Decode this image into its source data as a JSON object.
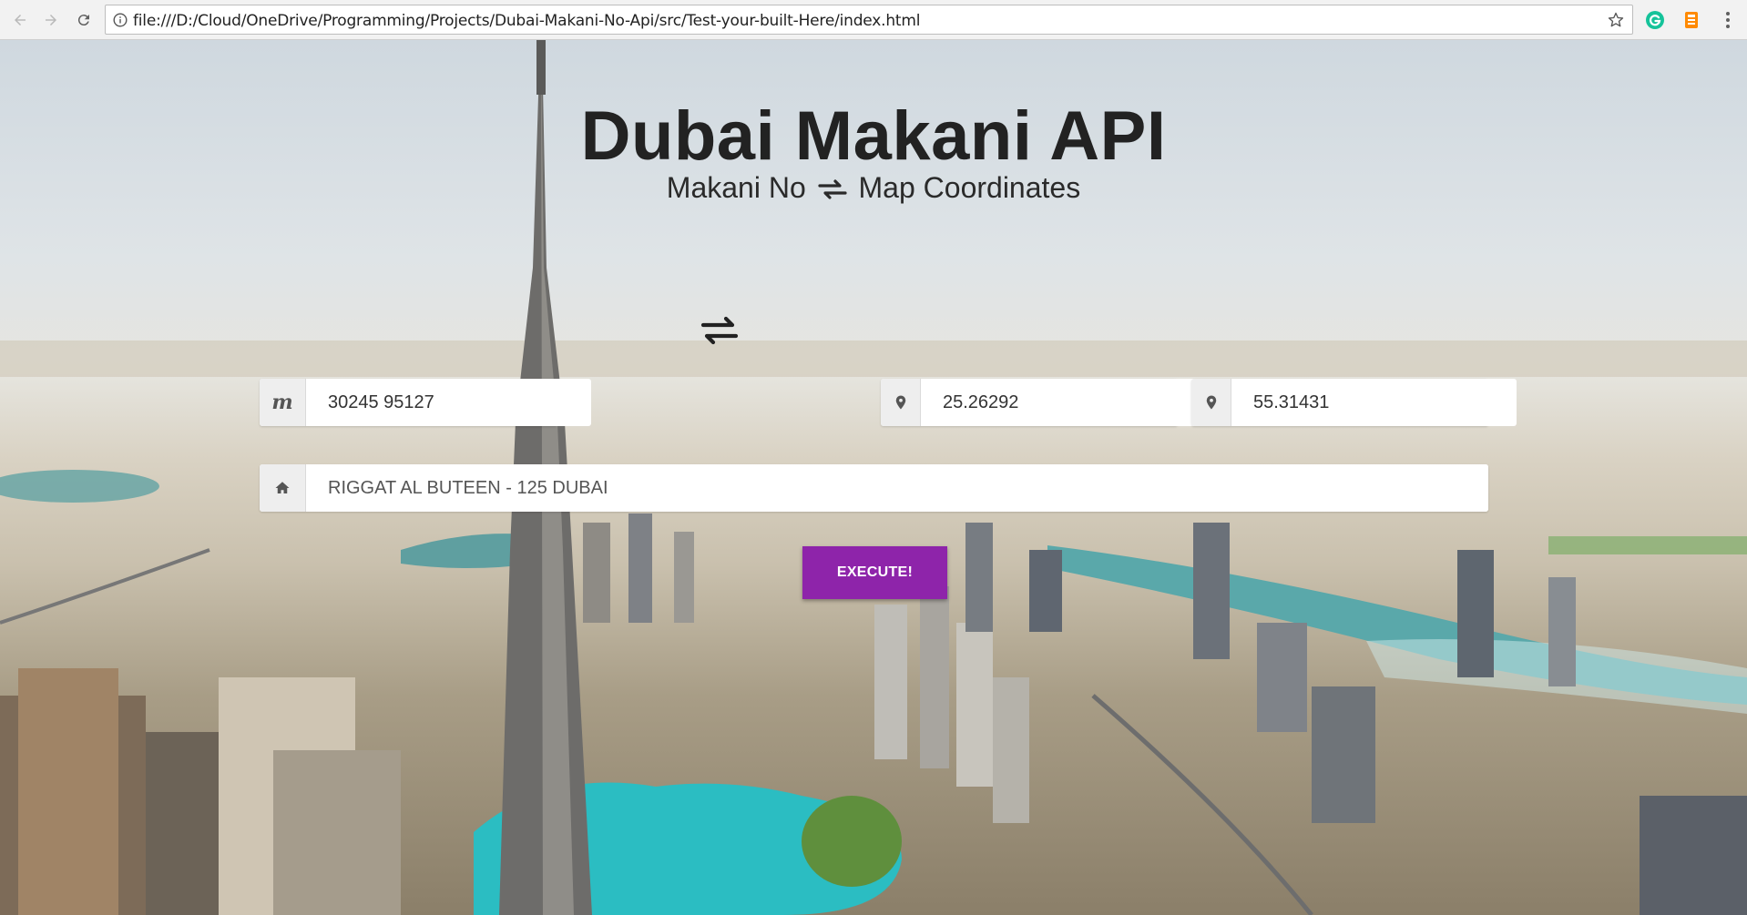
{
  "browser": {
    "url": "file:///D:/Cloud/OneDrive/Programming/Projects/Dubai-Makani-No-Api/src/Test-your-built-Here/index.html"
  },
  "hero": {
    "title": "Dubai Makani API",
    "subtitle_left": "Makani No",
    "subtitle_right": "Map Coordinates"
  },
  "form": {
    "makani_icon": "m",
    "makani_value": "30245 95127",
    "latitude_value": "25.26292",
    "longitude_value": "55.31431",
    "address_value": "RIGGAT AL BUTEEN - 125 DUBAI",
    "execute_label": "EXECUTE!"
  },
  "colors": {
    "execute_bg": "#8e24aa",
    "title": "#222222"
  },
  "icons": [
    "back-arrow-icon",
    "forward-arrow-icon",
    "reload-icon",
    "info-icon",
    "star-icon",
    "grammarly-icon",
    "extension-icon",
    "menu-icon",
    "map-marker-icon",
    "home-icon",
    "swap-arrows-icon"
  ]
}
